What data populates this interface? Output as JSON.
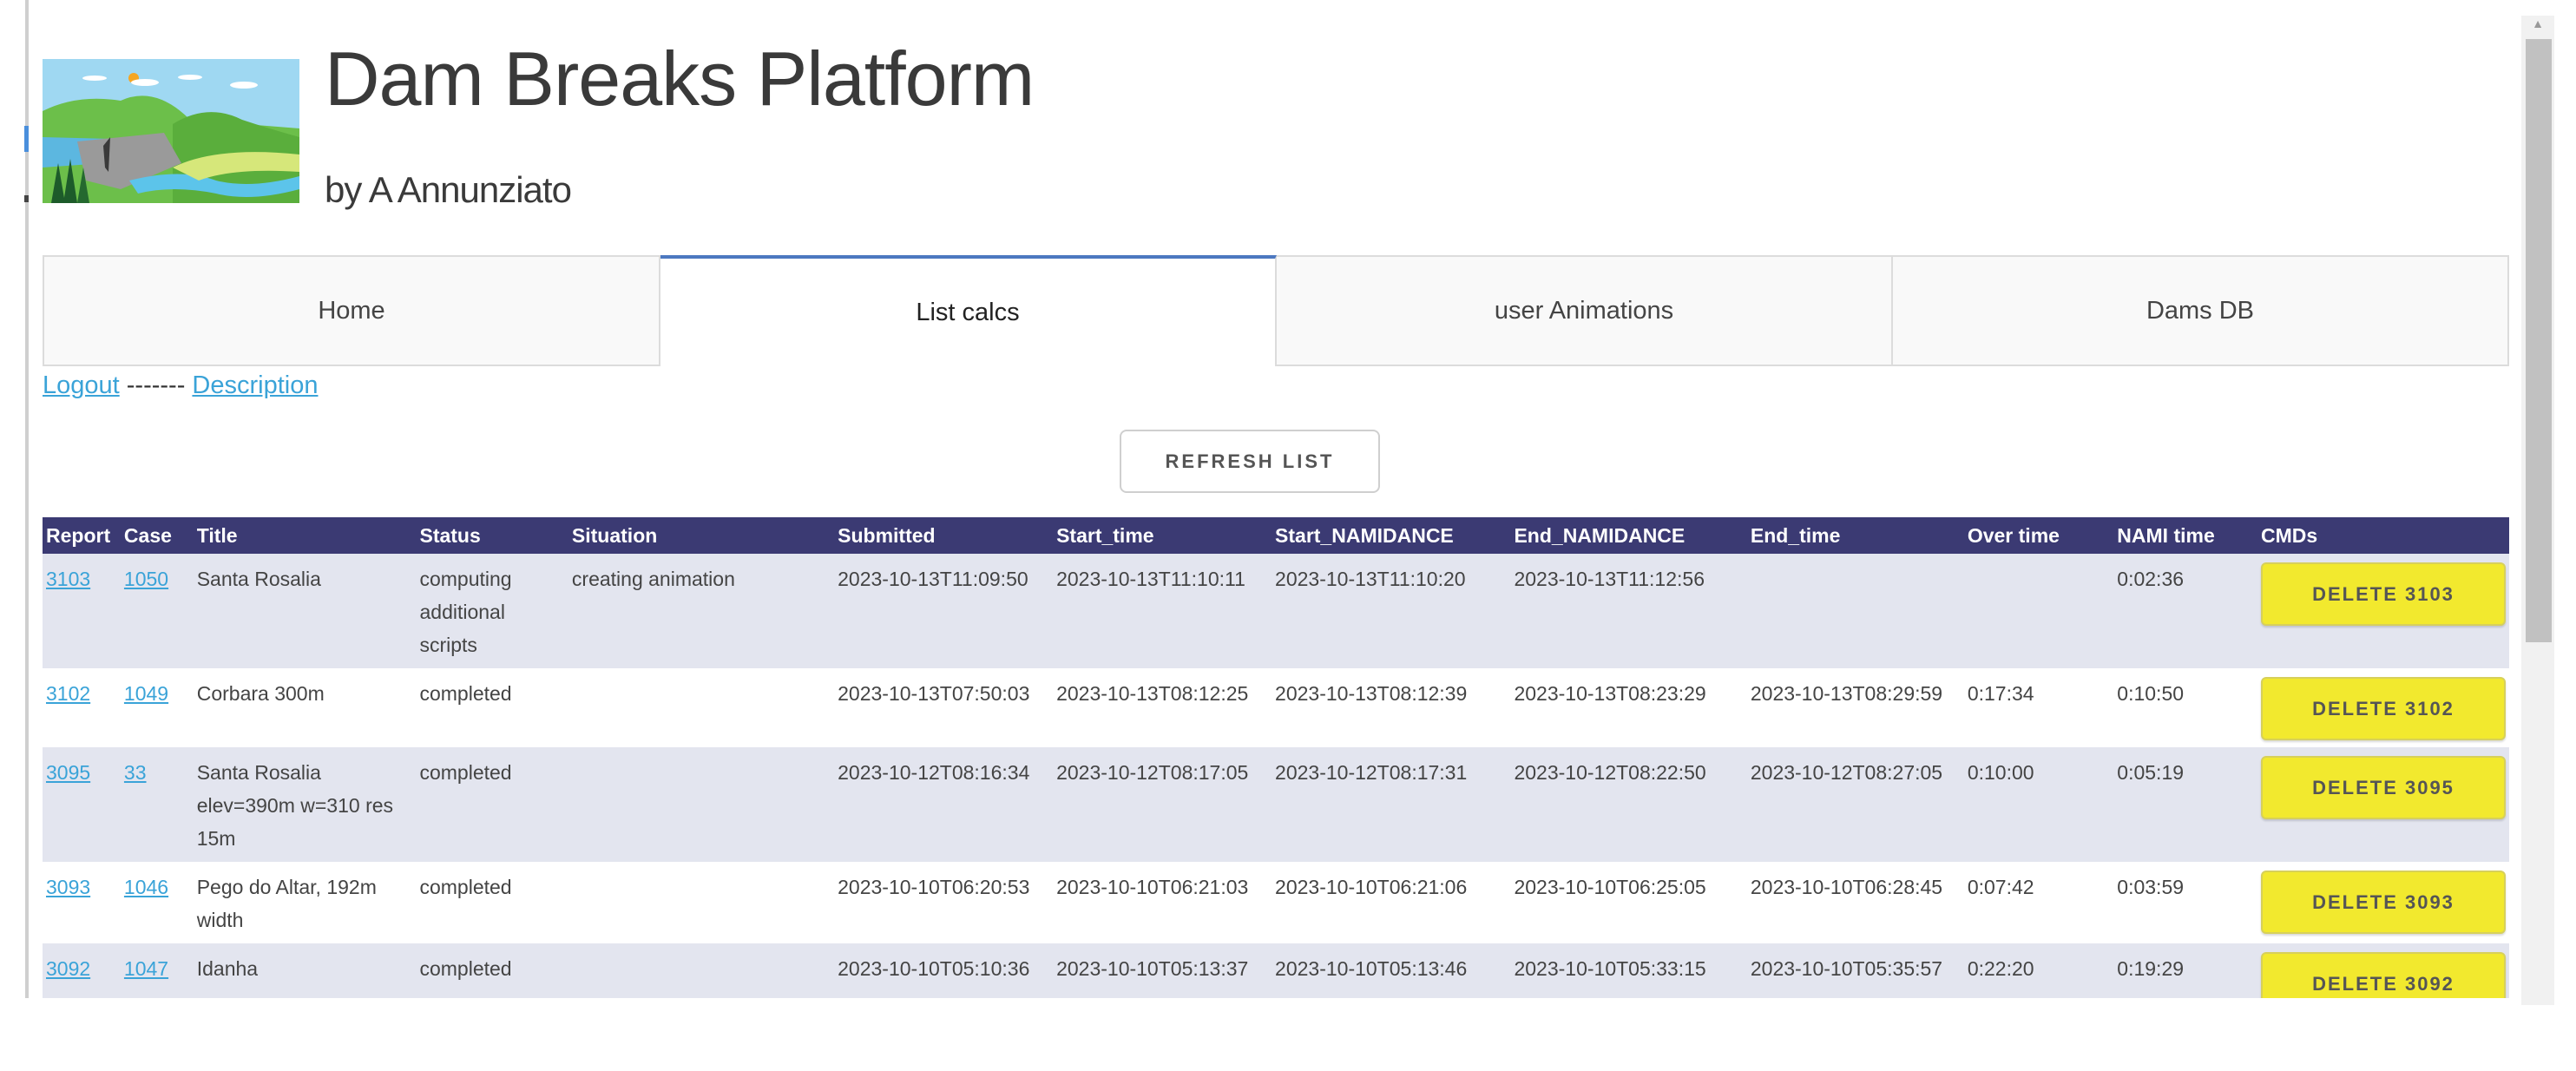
{
  "header": {
    "title": "Dam Breaks Platform",
    "subtitle": "by A Annunziato",
    "logo_alt": "dam-break-illustration"
  },
  "tabs": [
    {
      "label": "Home",
      "active": false
    },
    {
      "label": "List calcs",
      "active": true
    },
    {
      "label": "user Animations",
      "active": false
    },
    {
      "label": "Dams DB",
      "active": false
    }
  ],
  "links": {
    "logout": "Logout",
    "separator": " ------- ",
    "description": "Description"
  },
  "refresh_button": "REFRESH LIST",
  "table": {
    "columns": [
      "Report",
      "Case",
      "Title",
      "Status",
      "Situation",
      "Submitted",
      "Start_time",
      "Start_NAMIDANCE",
      "End_NAMIDANCE",
      "End_time",
      "Over time",
      "NAMI time",
      "CMDs"
    ],
    "rows": [
      {
        "report": "3103",
        "case": "1050",
        "title": "Santa Rosalia",
        "status": "computing additional scripts",
        "situation": "creating animation",
        "submitted": "2023-10-13T11:09:50",
        "start_time": "2023-10-13T11:10:11",
        "start_namidance": "2023-10-13T11:10:20",
        "end_namidance": "2023-10-13T11:12:56",
        "end_time": "",
        "over_time": "",
        "nami_time": "0:02:36",
        "cmd": "DELETE 3103"
      },
      {
        "report": "3102",
        "case": "1049",
        "title": "Corbara 300m",
        "status": "completed",
        "situation": "",
        "submitted": "2023-10-13T07:50:03",
        "start_time": "2023-10-13T08:12:25",
        "start_namidance": "2023-10-13T08:12:39",
        "end_namidance": "2023-10-13T08:23:29",
        "end_time": "2023-10-13T08:29:59",
        "over_time": "0:17:34",
        "nami_time": "0:10:50",
        "cmd": "DELETE 3102"
      },
      {
        "report": "3095",
        "case": "33",
        "title": "Santa Rosalia elev=390m w=310 res 15m",
        "status": "completed",
        "situation": "",
        "submitted": "2023-10-12T08:16:34",
        "start_time": "2023-10-12T08:17:05",
        "start_namidance": "2023-10-12T08:17:31",
        "end_namidance": "2023-10-12T08:22:50",
        "end_time": "2023-10-12T08:27:05",
        "over_time": "0:10:00",
        "nami_time": "0:05:19",
        "cmd": "DELETE 3095"
      },
      {
        "report": "3093",
        "case": "1046",
        "title": "Pego do Altar, 192m width",
        "status": "completed",
        "situation": "",
        "submitted": "2023-10-10T06:20:53",
        "start_time": "2023-10-10T06:21:03",
        "start_namidance": "2023-10-10T06:21:06",
        "end_namidance": "2023-10-10T06:25:05",
        "end_time": "2023-10-10T06:28:45",
        "over_time": "0:07:42",
        "nami_time": "0:03:59",
        "cmd": "DELETE 3093"
      },
      {
        "report": "3092",
        "case": "1047",
        "title": "Idanha",
        "status": "completed",
        "situation": "",
        "submitted": "2023-10-10T05:10:36",
        "start_time": "2023-10-10T05:13:37",
        "start_namidance": "2023-10-10T05:13:46",
        "end_namidance": "2023-10-10T05:33:15",
        "end_time": "2023-10-10T05:35:57",
        "over_time": "0:22:20",
        "nami_time": "0:19:29",
        "cmd": "DELETE 3092"
      }
    ]
  },
  "colors": {
    "header_bg": "#3b3a73",
    "row_alt_bg": "#e3e5ef",
    "delete_button": "#f2e92e",
    "link": "#3aa3d8",
    "active_tab_accent": "#4c78c0"
  }
}
